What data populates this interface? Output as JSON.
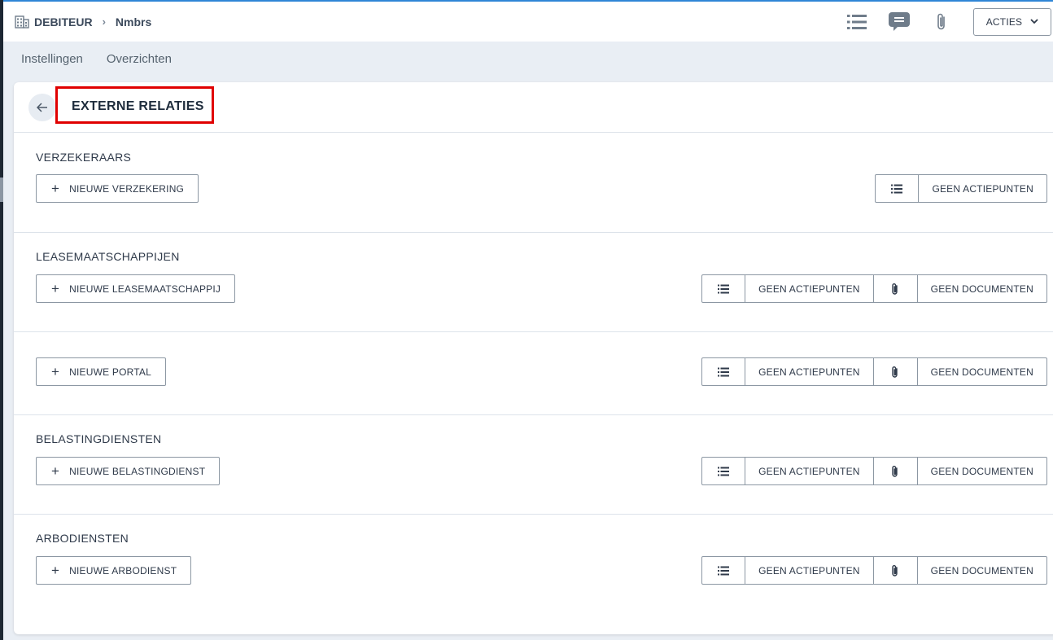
{
  "header": {
    "breadcrumb_root": "DEBITEUR",
    "breadcrumb_current": "Nmbrs",
    "acties_label": "ACTIES"
  },
  "subnav": {
    "items": [
      {
        "label": "Instellingen"
      },
      {
        "label": "Overzichten"
      }
    ]
  },
  "panel": {
    "title": "EXTERNE RELATIES"
  },
  "sections": [
    {
      "title": "VERZEKERAARS",
      "new_label": "NIEUWE VERZEKERING",
      "actions_label": "GEEN ACTIEPUNTEN"
    },
    {
      "title": "LEASEMAATSCHAPPIJEN",
      "new_label": "NIEUWE LEASEMAATSCHAPPIJ",
      "actions_label": "GEEN ACTIEPUNTEN",
      "documents_label": "GEEN DOCUMENTEN"
    },
    {
      "title": "",
      "new_label": "NIEUWE PORTAL",
      "actions_label": "GEEN ACTIEPUNTEN",
      "documents_label": "GEEN DOCUMENTEN"
    },
    {
      "title": "BELASTINGDIENSTEN",
      "new_label": "NIEUWE BELASTINGDIENST",
      "actions_label": "GEEN ACTIEPUNTEN",
      "documents_label": "GEEN DOCUMENTEN"
    },
    {
      "title": "ARBODIENSTEN",
      "new_label": "NIEUWE ARBODIENST",
      "actions_label": "GEEN ACTIEPUNTEN",
      "documents_label": "GEEN DOCUMENTEN"
    }
  ],
  "colors": {
    "highlight_border": "#e00000",
    "accent_top": "#2f86d6"
  }
}
